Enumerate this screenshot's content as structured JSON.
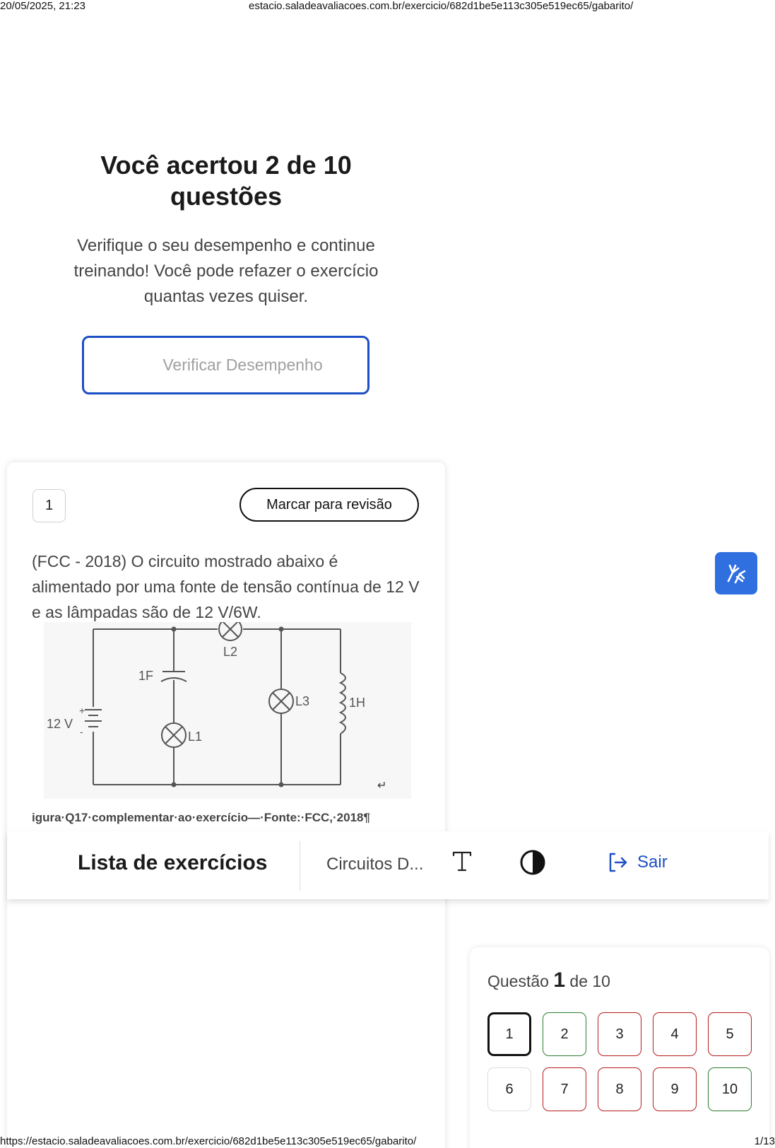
{
  "print_header": {
    "datetime": "20/05/2025, 21:23",
    "url": "estacio.saladeavaliacoes.com.br/exercicio/682d1be5e113c305e519ec65/gabarito/"
  },
  "print_footer": {
    "url": "https://estacio.saladeavaliacoes.com.br/exercicio/682d1be5e113c305e519ec65/gabarito/",
    "page": "1/13"
  },
  "result": {
    "title": "Você acertou 2 de 10 questões",
    "message": "Verifique o seu desempenho e continue treinando! Você pode refazer o exercício quantas vezes quiser.",
    "verify_button": "Verificar Desempenho"
  },
  "question": {
    "number": "1",
    "mark_review": "Marcar para revisão",
    "text": "(FCC - 2018) O circuito mostrado abaixo é alimentado por uma fonte de tensão contínua de 12 V e as lâmpadas são de 12 V/6W.",
    "circuit_labels": {
      "source": "12 V",
      "plus": "+",
      "minus": "-",
      "capacitor": "1F",
      "lamp1": "L1",
      "lamp2": "L2",
      "lamp3": "L3",
      "inductor": "1H",
      "return_mark": "↵"
    },
    "caption": "igura·Q17·complementar·ao·exercício—·Fonte:·FCC,·2018¶"
  },
  "topbar": {
    "title": "Lista de exercícios",
    "course": "Circuitos D...",
    "text_size_icon": "text-size-icon",
    "contrast_icon": "contrast-icon",
    "exit_label": "Sair"
  },
  "navigator": {
    "prefix": "Questão",
    "current": "1",
    "suffix": "de 10",
    "questions": [
      {
        "n": "1",
        "state": "current"
      },
      {
        "n": "2",
        "state": "correct"
      },
      {
        "n": "3",
        "state": "wrong"
      },
      {
        "n": "4",
        "state": "wrong"
      },
      {
        "n": "5",
        "state": "wrong"
      },
      {
        "n": "6",
        "state": "none"
      },
      {
        "n": "7",
        "state": "wrong"
      },
      {
        "n": "8",
        "state": "wrong"
      },
      {
        "n": "9",
        "state": "wrong"
      },
      {
        "n": "10",
        "state": "correct"
      }
    ]
  },
  "colors": {
    "accent_blue": "#1d4fc4",
    "correct_green": "#2e7d32",
    "wrong_red": "#b71c1c",
    "accessibility_blue": "#2f6fe0"
  }
}
